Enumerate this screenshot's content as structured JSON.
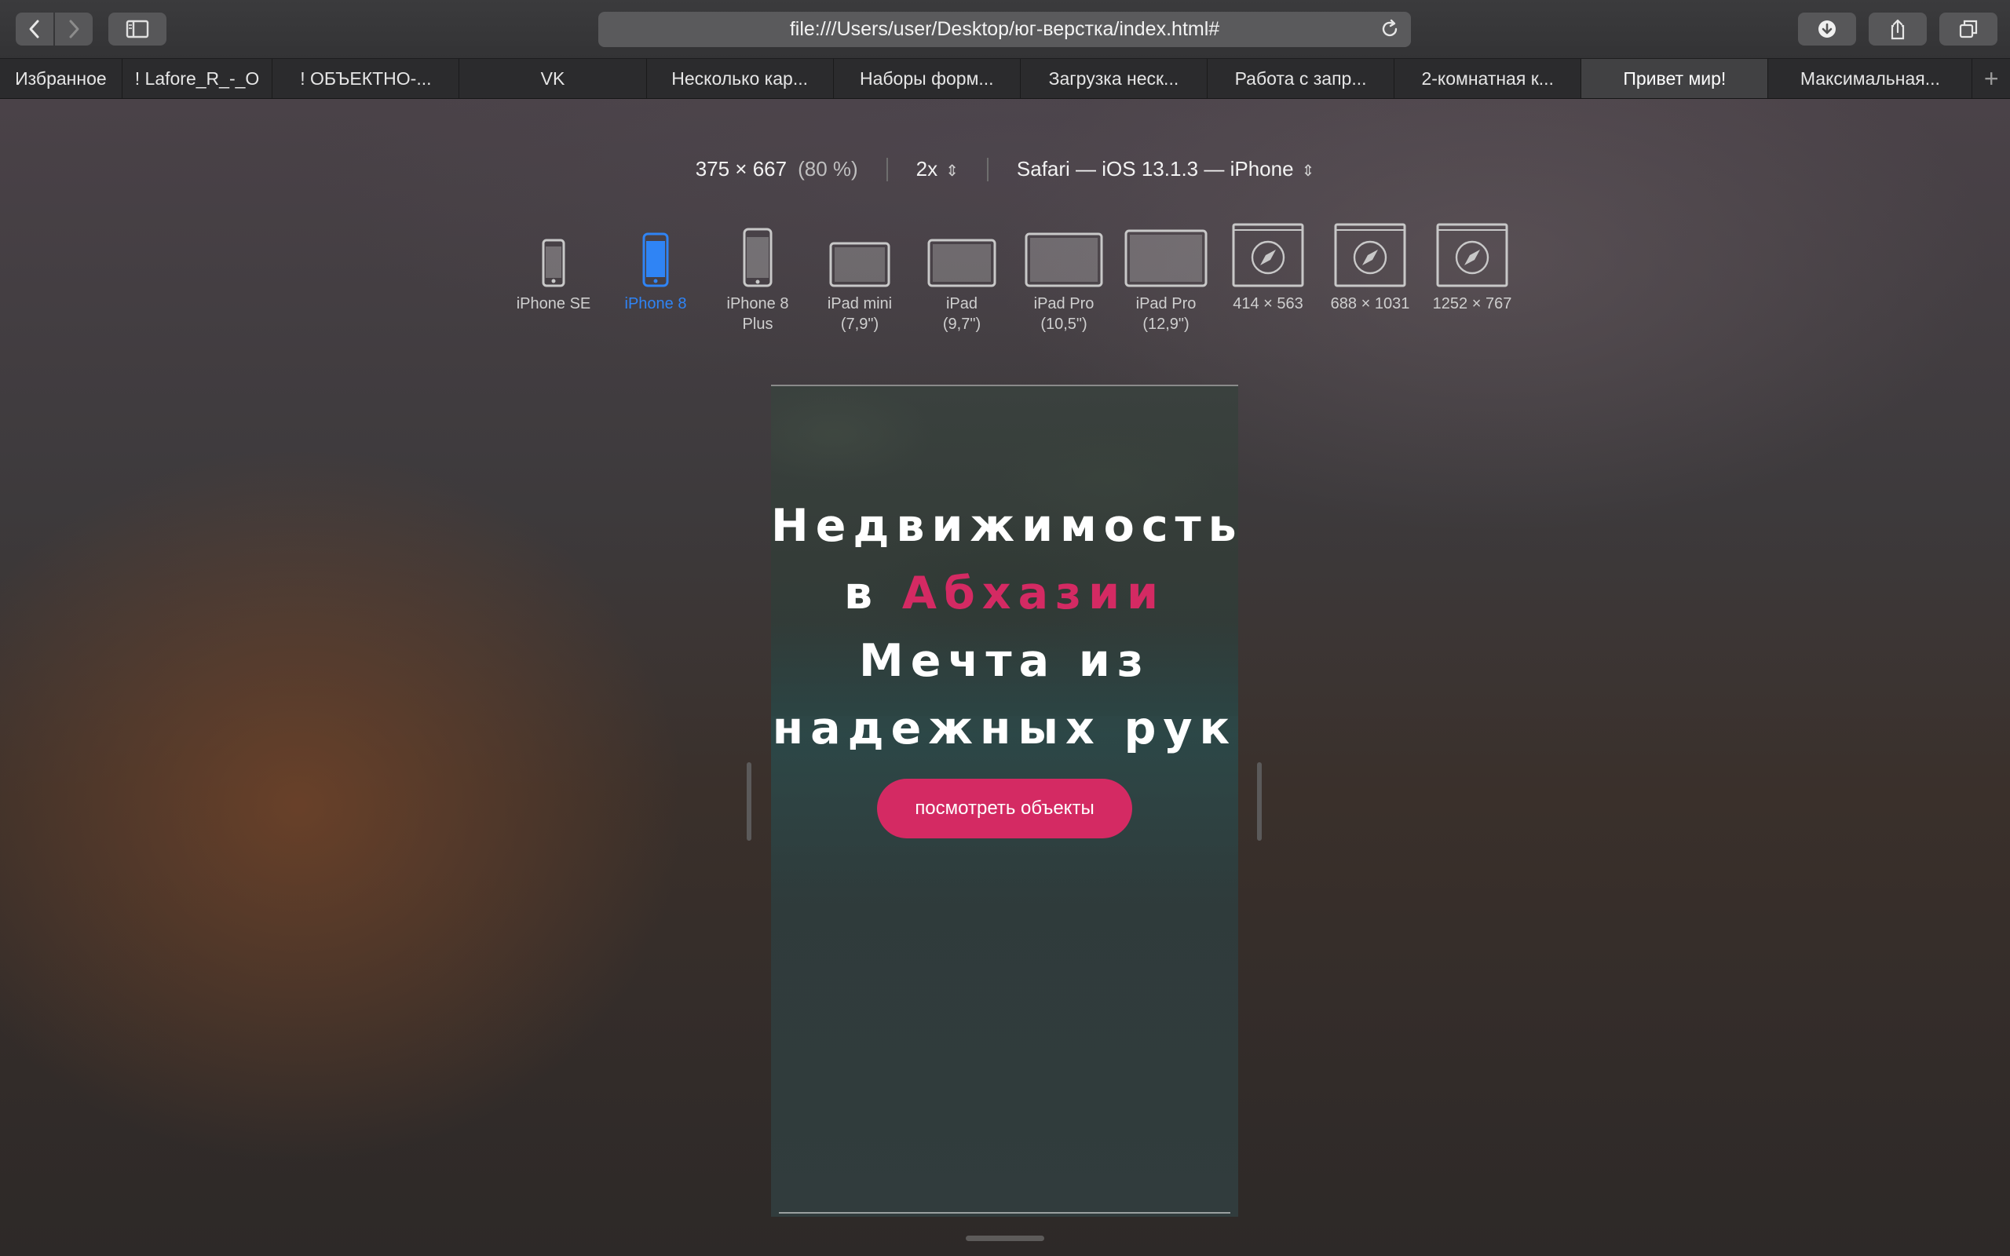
{
  "toolbar": {
    "url": "file:///Users/user/Desktop/юг-верстка/index.html#"
  },
  "tabs": [
    {
      "label": "Избранное",
      "active": false
    },
    {
      "label": "! Lafore_R_-_O",
      "active": false
    },
    {
      "label": "! ОБЪЕКТНО-...",
      "active": false
    },
    {
      "label": "VK",
      "active": false
    },
    {
      "label": "Несколько кар...",
      "active": false
    },
    {
      "label": "Наборы форм...",
      "active": false
    },
    {
      "label": "Загрузка неск...",
      "active": false
    },
    {
      "label": "Работа с запр...",
      "active": false
    },
    {
      "label": "2-комнатная к...",
      "active": false
    },
    {
      "label": "Привет мир!",
      "active": true
    },
    {
      "label": "Максимальная...",
      "active": false
    }
  ],
  "responsive": {
    "size": "375 × 667",
    "zoom": "(80 %)",
    "scale": "2x",
    "agent": "Safari — iOS 13.1.3 — iPhone",
    "devices": [
      {
        "line1": "iPhone SE",
        "line2": "",
        "icon": "phone-icon",
        "selected": false
      },
      {
        "line1": "iPhone 8",
        "line2": "",
        "icon": "phone-icon",
        "selected": true
      },
      {
        "line1": "iPhone 8",
        "line2": "Plus",
        "icon": "phone-icon",
        "selected": false
      },
      {
        "line1": "iPad mini",
        "line2": "(7,9\")",
        "icon": "tablet-icon",
        "selected": false
      },
      {
        "line1": "iPad",
        "line2": "(9,7\")",
        "icon": "tablet-icon",
        "selected": false
      },
      {
        "line1": "iPad Pro",
        "line2": "(10,5\")",
        "icon": "tablet-icon",
        "selected": false
      },
      {
        "line1": "iPad Pro",
        "line2": "(12,9\")",
        "icon": "tablet-icon",
        "selected": false
      },
      {
        "line1": "414 × 563",
        "line2": "",
        "icon": "safari-window-icon",
        "selected": false
      },
      {
        "line1": "688 × 1031",
        "line2": "",
        "icon": "safari-window-icon",
        "selected": false
      },
      {
        "line1": "1252 × 767",
        "line2": "",
        "icon": "safari-window-icon",
        "selected": false
      }
    ]
  },
  "page": {
    "title_line1": "Недвижимость",
    "title_line2_prefix": "в",
    "title_line2_accent": "Абхазии",
    "title_line3": "Мечта из",
    "title_line4": "надежных рук",
    "cta_label": "посмотреть объекты",
    "accent_color": "#d42a63"
  },
  "colors": {
    "selected_device": "#2f84f5"
  }
}
